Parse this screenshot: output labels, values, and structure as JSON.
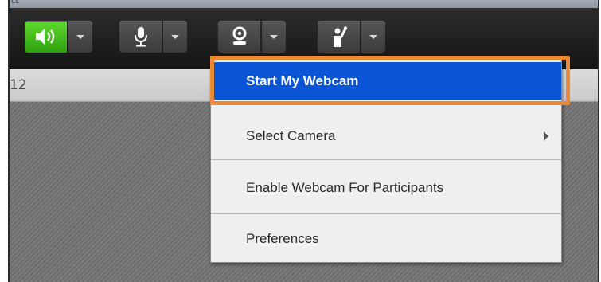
{
  "window": {
    "title_fragment": "ct"
  },
  "toolbar": {
    "buttons": [
      {
        "icon": "speaker-icon",
        "active": true
      },
      {
        "icon": "microphone-icon",
        "active": false
      },
      {
        "icon": "webcam-icon",
        "active": false
      },
      {
        "icon": "raise-hand-icon",
        "active": false
      }
    ]
  },
  "statusbar": {
    "count": "12"
  },
  "menu": {
    "items": [
      {
        "label": "Start My Webcam",
        "selected": true
      },
      {
        "label": "Select Camera",
        "has_submenu": true
      },
      {
        "label": "Enable Webcam For Participants"
      },
      {
        "label": "Preferences"
      }
    ]
  },
  "colors": {
    "highlight": "#ee8a36",
    "menu_selection": "#0a55d6",
    "active_button": "#3fbf1a"
  }
}
